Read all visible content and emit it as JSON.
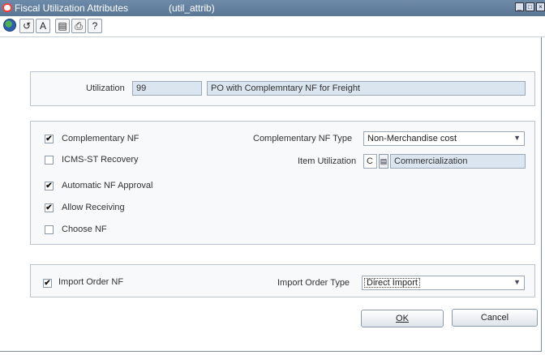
{
  "window": {
    "title": "Fiscal Utilization Attributes",
    "form_name": "(util_attrib)"
  },
  "toolbar": {
    "icons": [
      "globe-icon",
      "exit-icon",
      "spell-check-icon",
      "copy-icon",
      "print-icon",
      "help-icon"
    ],
    "glyphs": {
      "exit": "↺",
      "spell": "A",
      "copy": "▤",
      "print": "⎙",
      "help": "?"
    }
  },
  "utilization": {
    "label": "Utilization",
    "code": "99",
    "description": "PO with Complemntary NF for  Freight"
  },
  "attributes": {
    "complementary_nf": {
      "label": "Complementary NF",
      "checked": true
    },
    "icms_st_recovery": {
      "label": "ICMS-ST Recovery",
      "checked": false
    },
    "automatic_nf_approval": {
      "label": "Automatic NF Approval",
      "checked": true
    },
    "allow_receiving": {
      "label": "Allow Receiving",
      "checked": true
    },
    "choose_nf": {
      "label": "Choose NF",
      "checked": false
    },
    "complementary_nf_type": {
      "label": "Complementary NF Type",
      "value": "Non-Merchandise cost"
    },
    "item_utilization": {
      "label": "Item Utilization",
      "code": "C",
      "description": "Commercialization"
    }
  },
  "import": {
    "import_order_nf": {
      "label": "Import Order NF",
      "checked": true
    },
    "import_order_type": {
      "label": "Import Order Type",
      "value": "Direct Import"
    }
  },
  "buttons": {
    "ok": "OK",
    "cancel": "Cancel"
  },
  "check_glyph": "✔"
}
